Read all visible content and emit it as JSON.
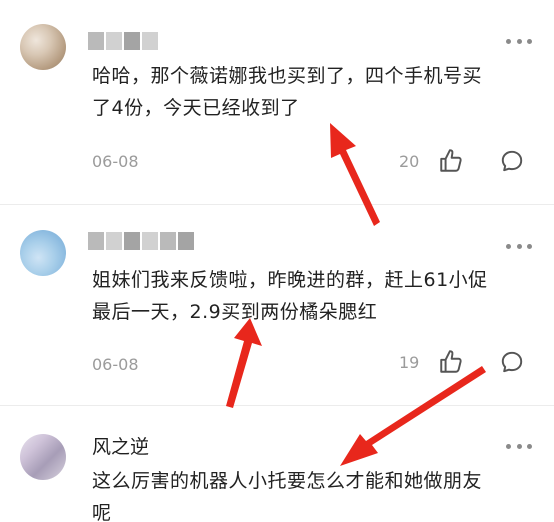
{
  "comments": [
    {
      "username": "",
      "text_line1": "哈哈，那个薇诺娜我也买到了，四个手机号买",
      "text_line2": "了4份，今天已经收到了",
      "date": "06-08",
      "likes": "20"
    },
    {
      "username": "",
      "text_line1": "姐妹们我来反馈啦，昨晚进的群，赶上61小促",
      "text_line2": "最后一天，2.9买到两份橘朵腮红",
      "date": "06-08",
      "likes": "19"
    },
    {
      "username": "风之逆",
      "text_line1": "这么厉害的机器人小托要怎么才能和她做朋友",
      "text_line2": "呢"
    }
  ],
  "icons": {
    "more": "more-dots-icon",
    "like": "thumbs-up-icon",
    "reply": "comment-bubble-icon",
    "annotation": "red-arrow-icon"
  },
  "colors": {
    "annotation_arrow": "#e8271c",
    "text": "#222222",
    "meta": "#9b9b9b"
  }
}
